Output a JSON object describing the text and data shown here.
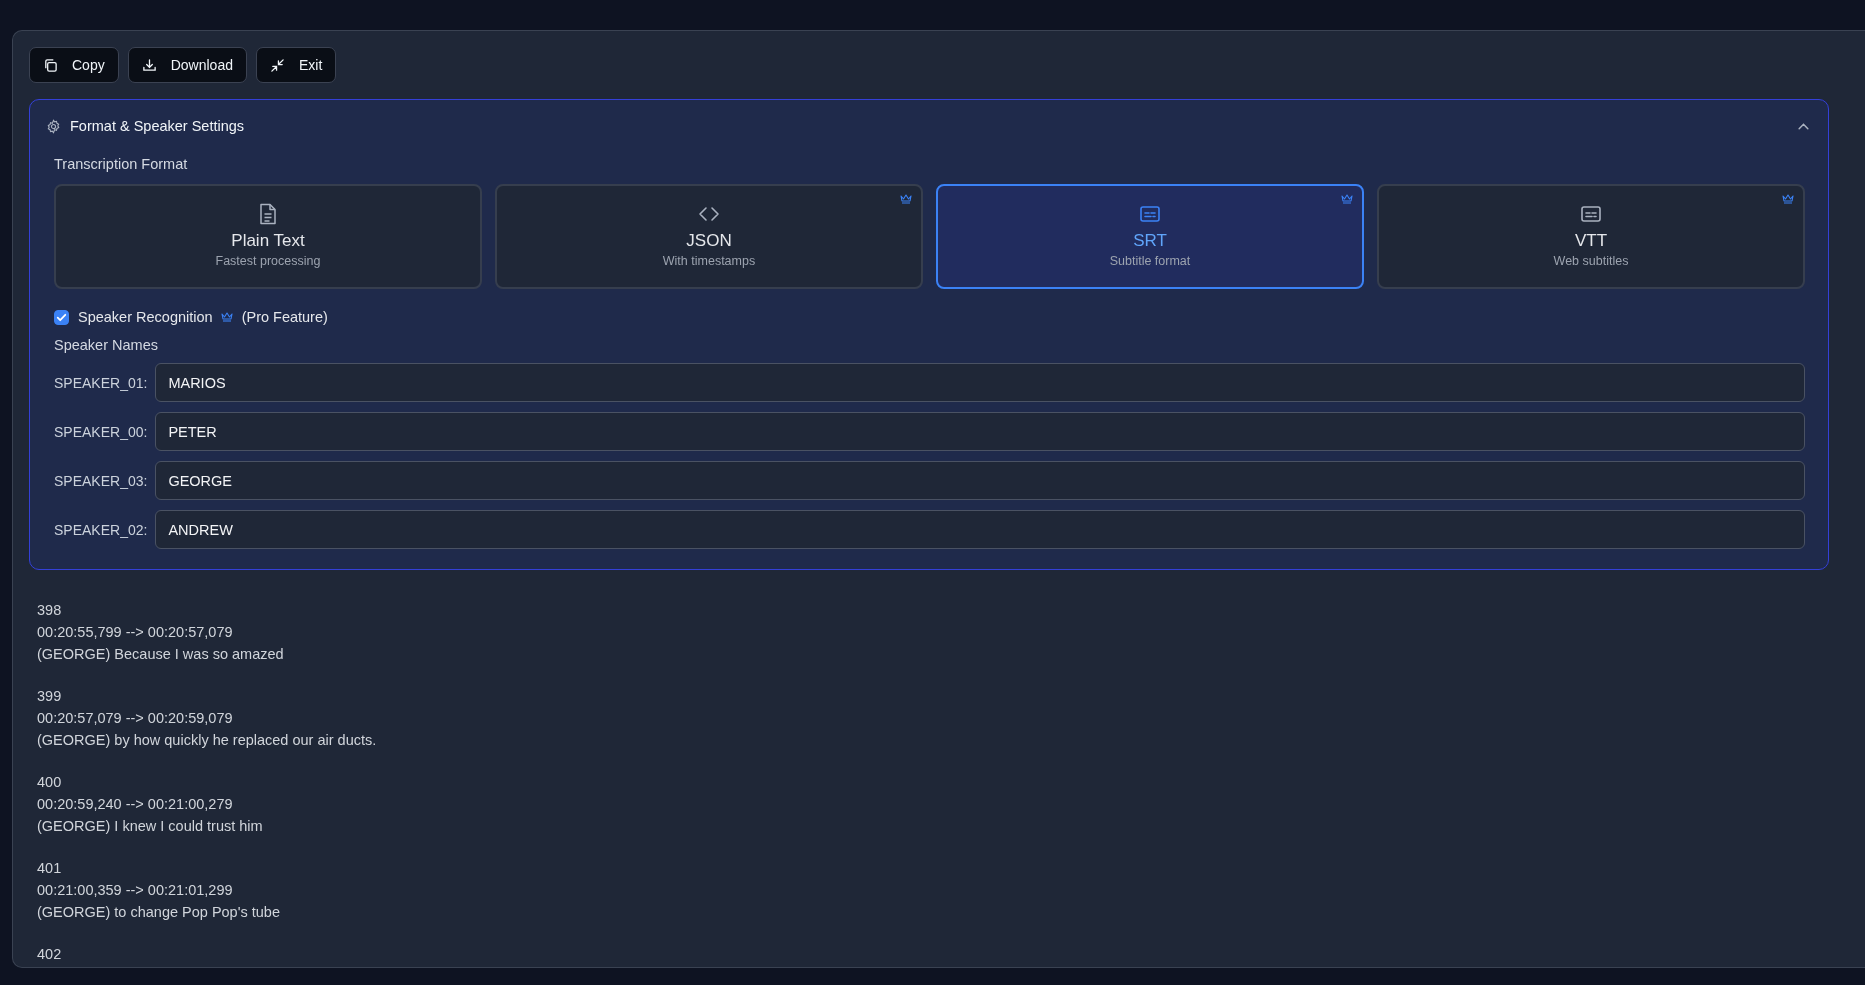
{
  "toolbar": {
    "buttons": [
      {
        "label": "Copy",
        "kind": "copy"
      },
      {
        "label": "Download",
        "kind": "download"
      },
      {
        "label": "Exit",
        "kind": "collapse"
      }
    ]
  },
  "settings": {
    "title": "Format & Speaker Settings",
    "expanded": true,
    "format_label": "Transcription Format",
    "formats": [
      {
        "name": "Plain Text",
        "description": "Fastest processing",
        "kind": "document",
        "pro": false,
        "selected": false
      },
      {
        "name": "JSON",
        "description": "With timestamps",
        "kind": "code",
        "pro": true,
        "selected": false
      },
      {
        "name": "SRT",
        "description": "Subtitle format",
        "kind": "subtitles",
        "pro": true,
        "selected": true
      },
      {
        "name": "VTT",
        "description": "Web subtitles",
        "kind": "subtitles",
        "pro": true,
        "selected": false
      }
    ],
    "speaker_recognition": {
      "label": "Speaker Recognition",
      "note": "(Pro Feature)",
      "checked": true,
      "pro": true
    },
    "speaker_names_label": "Speaker Names",
    "speakers": [
      {
        "label": "SPEAKER_01:",
        "value": "MARIOS"
      },
      {
        "label": "SPEAKER_00:",
        "value": "PETER"
      },
      {
        "label": "SPEAKER_03:",
        "value": "GEORGE"
      },
      {
        "label": "SPEAKER_02:",
        "value": "ANDREW"
      }
    ]
  },
  "transcript": [
    {
      "index": "398",
      "time": "00:20:55,799 --> 00:20:57,079",
      "text": "(GEORGE) Because I was so amazed"
    },
    {
      "index": "399",
      "time": "00:20:57,079 --> 00:20:59,079",
      "text": "(GEORGE) by how quickly he replaced our air ducts."
    },
    {
      "index": "400",
      "time": "00:20:59,240 --> 00:21:00,279",
      "text": "(GEORGE) I knew I could trust him"
    },
    {
      "index": "401",
      "time": "00:21:00,359 --> 00:21:01,299",
      "text": "(GEORGE) to change Pop Pop's tube"
    },
    {
      "index": "402"
    }
  ]
}
